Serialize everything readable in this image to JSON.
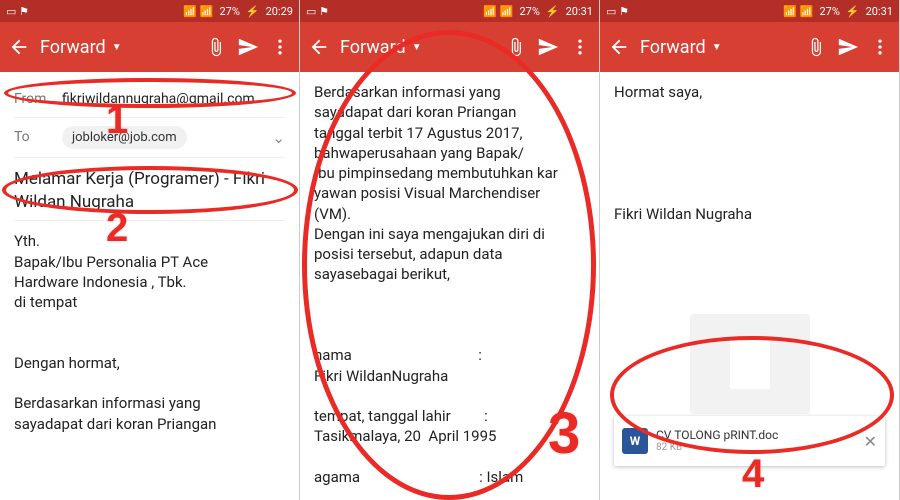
{
  "status": {
    "battery": "27%",
    "t1": "20:29",
    "t2": "20:31",
    "t3": "20:31"
  },
  "appbar": {
    "title": "Forward"
  },
  "p1": {
    "from_label": "From",
    "from_value": "fikriwildannugraha@gmail.com",
    "to_label": "To",
    "to_value": "jobloker@job.com",
    "subject": "Melamar Kerja (Programer) - Fikri Wildan Nugraha",
    "body": "Yth.\nBapak/Ibu Personalia PT Ace\nHardware Indonesia , Tbk.\ndi tempat\n\n\nDengan hormat,\n\nBerdasarkan informasi yang\nsayadapat dari koran Priangan"
  },
  "p2": {
    "body": "Berdasarkan informasi yang\nsayadapat dari koran Priangan\ntanggal terbit 17 Agustus 2017,\nbahwaperusahaan yang Bapak/\nIbu pimpinsedang membutuhkan kar\nyawan posisi Visual Marchendiser\n(VM).\nDengan ini saya mengajukan diri di\nposisi tersebut, adapun data\nsayasebagai berikut,\n\n\n\nnama                                  :\nFikri WildanNugraha\n\ntempat, tanggal lahir         :\nTasikmalaya, 20  April 1995\n\nagama                                : Islam"
  },
  "p3": {
    "body": "Hormat saya,\n\n\n\n\n\nFikri Wildan Nugraha",
    "att_name": "CV TOLONG pRINT.doc",
    "att_size": "82 KB",
    "att_badge": "W"
  },
  "annotations": {
    "n1": "1",
    "n2": "2",
    "n3": "3",
    "n4": "4"
  }
}
